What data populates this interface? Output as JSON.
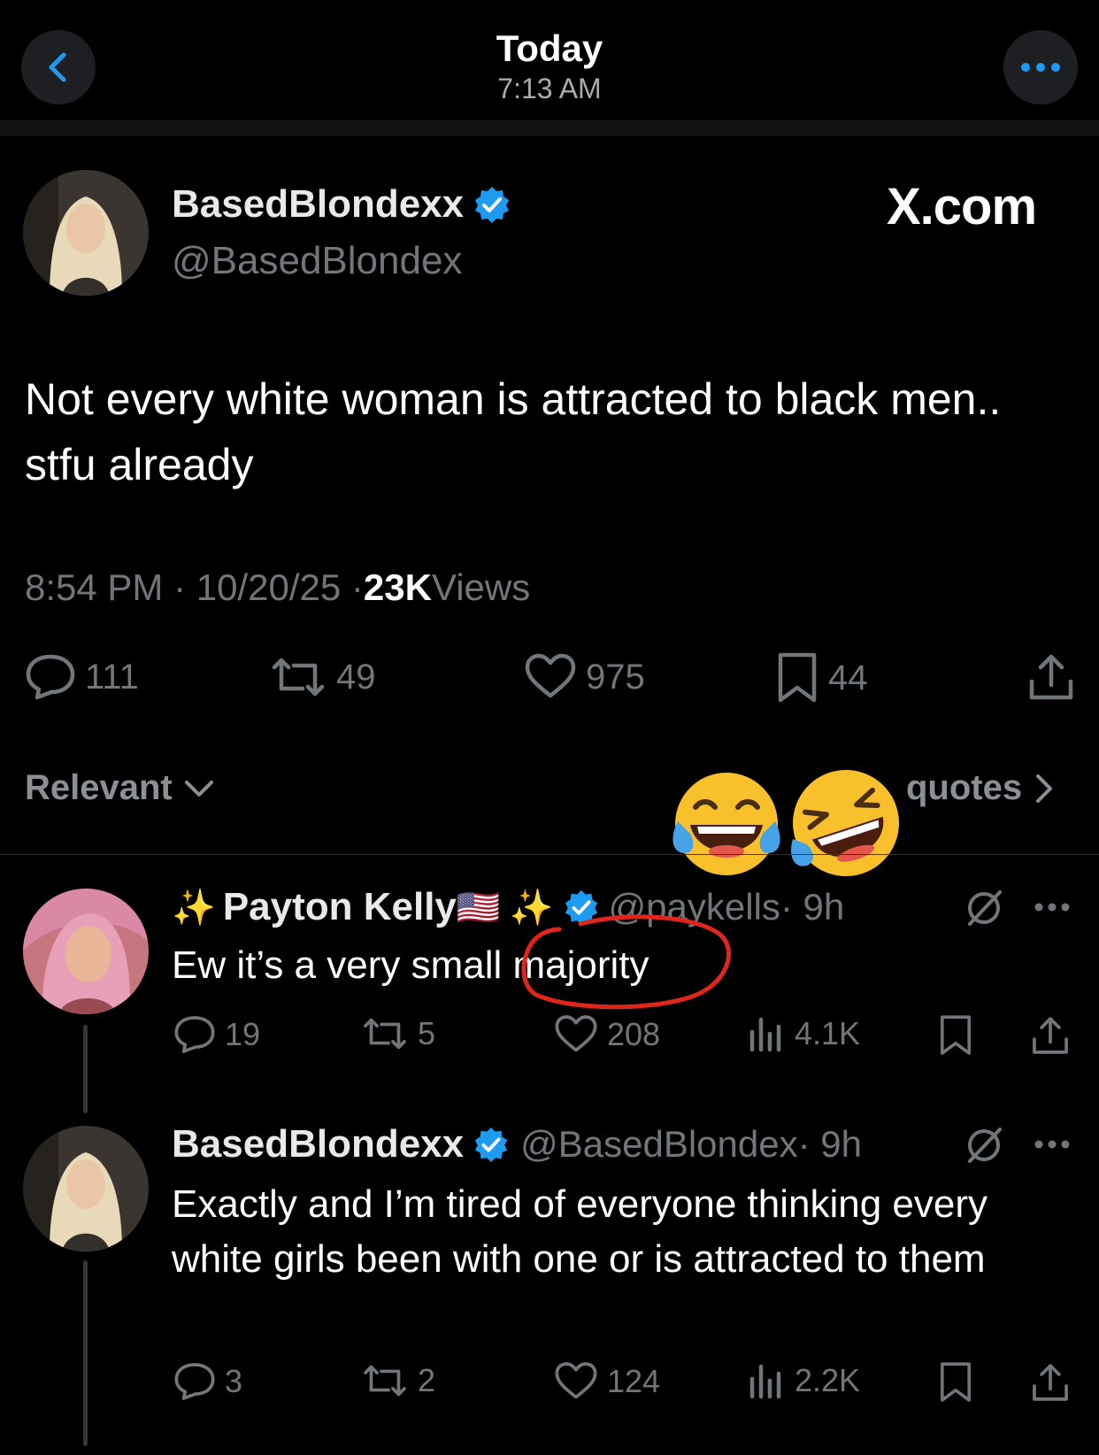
{
  "header": {
    "title": "Today",
    "time": "7:13 AM"
  },
  "colors": {
    "accent": "#1d9bf0",
    "muted": "#71767b",
    "annotation": "#e0261a"
  },
  "tweet": {
    "author": "BasedBlondexx",
    "handle": "@BasedBlondex",
    "source": "X.com",
    "text": "Not every white woman is attracted to black men.. stfu already",
    "timestamp": "8:54 PM · 10/20/25 · ",
    "views_count": "23K",
    "views_label": " Views",
    "stats": {
      "replies": "111",
      "reposts": "49",
      "likes": "975",
      "bookmarks": "44"
    }
  },
  "filters": {
    "sort": "Relevant",
    "quotes": "quotes"
  },
  "overlay_emojis": [
    "😂",
    "🤣"
  ],
  "replies": [
    {
      "author": "Payton Kelly",
      "name_emojis": [
        "✨",
        "🇺🇸",
        "✨"
      ],
      "handle": "@paykells",
      "time": " · 9h",
      "text_before": "Ew it’s a very small ",
      "text_highlight": "majority",
      "stats": {
        "replies": "19",
        "reposts": "5",
        "likes": "208",
        "views": "4.1K"
      }
    },
    {
      "author": "BasedBlondexx",
      "handle": "@BasedBlondex",
      "time": " · 9h",
      "text": "Exactly and I’m tired of everyone thinking every white girls been with one or is attracted to them",
      "stats": {
        "replies": "3",
        "reposts": "2",
        "likes": "124",
        "views": "2.2K"
      }
    }
  ]
}
